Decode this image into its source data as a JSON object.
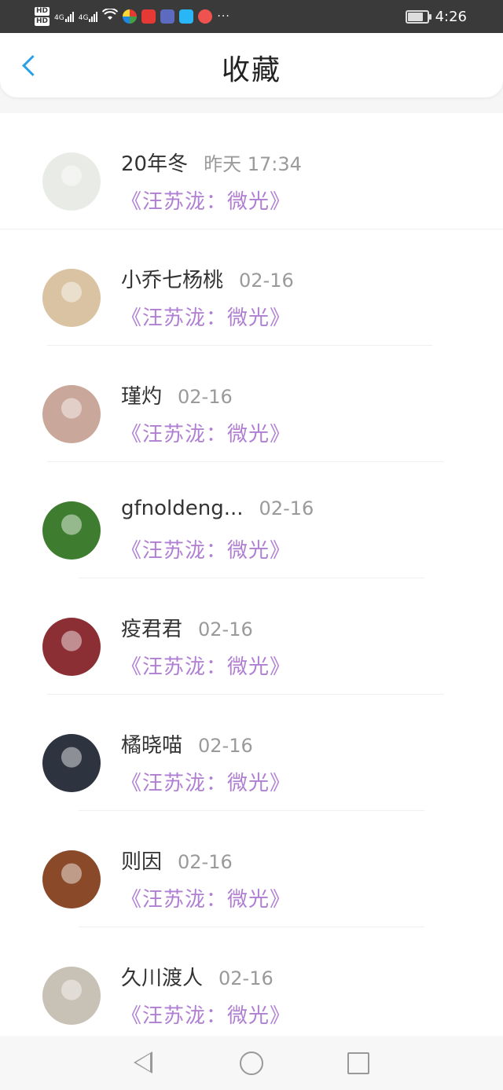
{
  "status_bar": {
    "sim1": "HD",
    "sim2": "HD",
    "net1": "4G",
    "net2": "4G",
    "overflow": "···",
    "time": "4:26",
    "battery_level": 0.8
  },
  "header": {
    "title": "收藏",
    "back_icon": "chevron-left-icon",
    "accent": "#2aa1e6"
  },
  "colors": {
    "quote": "#b07fd3",
    "time": "#9a9a9a"
  },
  "items": [
    {
      "name": "20年冬",
      "time": "昨天 17:34",
      "quote": "《汪苏泷：微光》",
      "avatar_bg": "#e9ece6"
    },
    {
      "name": "小乔七杨桃",
      "time": "02-16",
      "quote": "《汪苏泷：微光》",
      "avatar_bg": "#d9c3a2"
    },
    {
      "name": "瑾灼",
      "time": "02-16",
      "quote": "《汪苏泷：微光》",
      "avatar_bg": "#c9a79a"
    },
    {
      "name": "gfnoldeng...",
      "time": "02-16",
      "quote": "《汪苏泷：微光》",
      "avatar_bg": "#3e7d2f"
    },
    {
      "name": "疫君君",
      "time": "02-16",
      "quote": "《汪苏泷：微光》",
      "avatar_bg": "#8c2f34"
    },
    {
      "name": "橘晓喵",
      "time": "02-16",
      "quote": "《汪苏泷：微光》",
      "avatar_bg": "#2e3340"
    },
    {
      "name": "则因",
      "time": "02-16",
      "quote": "《汪苏泷：微光》",
      "avatar_bg": "#8a4a2a"
    },
    {
      "name": "久川渡人",
      "time": "02-16",
      "quote": "《汪苏泷：微光》",
      "avatar_bg": "#c8c1b5"
    }
  ]
}
